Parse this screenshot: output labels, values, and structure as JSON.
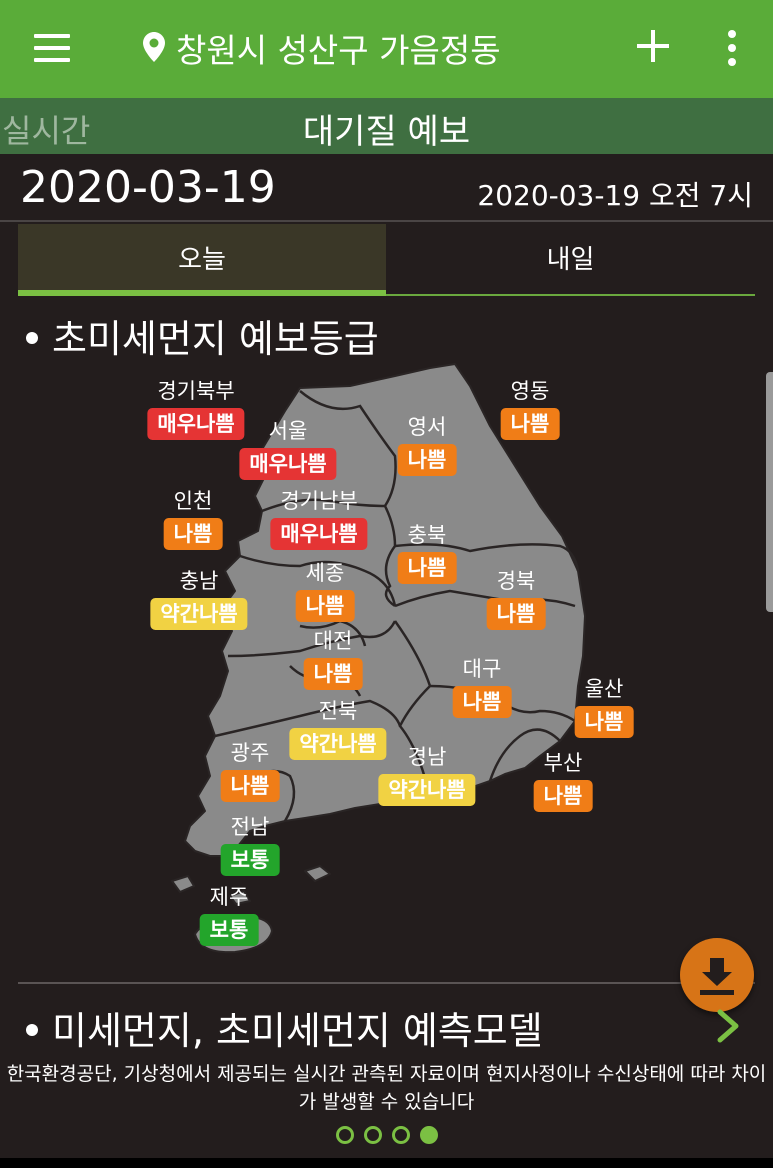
{
  "appbar": {
    "location": "창원시 성산구 가음정동",
    "menu_icon": "hamburger-menu-icon",
    "location_icon": "map-pin-icon",
    "add_icon": "plus-icon",
    "more_icon": "more-vertical-icon"
  },
  "subbar": {
    "prev_label": "실시간",
    "title": "대기질 예보"
  },
  "dateline": {
    "date": "2020-03-19",
    "updated": "2020-03-19 오전 7시"
  },
  "tabs": {
    "today": "오늘",
    "tomorrow": "내일"
  },
  "section1": {
    "title": "초미세먼지 예보등급"
  },
  "section2": {
    "title": "미세먼지, 초미세먼지 예측모델"
  },
  "grade_colors": {
    "매우나쁨": "#e53434",
    "나쁨": "#f07d17",
    "약간나쁨": "#f1d243",
    "보통": "#23a52b"
  },
  "regions": [
    {
      "name": "경기북부",
      "grade": "매우나쁨"
    },
    {
      "name": "서울",
      "grade": "매우나쁨"
    },
    {
      "name": "영서",
      "grade": "나쁨"
    },
    {
      "name": "영동",
      "grade": "나쁨"
    },
    {
      "name": "인천",
      "grade": "나쁨"
    },
    {
      "name": "경기남부",
      "grade": "매우나쁨"
    },
    {
      "name": "충북",
      "grade": "나쁨"
    },
    {
      "name": "충남",
      "grade": "약간나쁨"
    },
    {
      "name": "세종",
      "grade": "나쁨"
    },
    {
      "name": "경북",
      "grade": "나쁨"
    },
    {
      "name": "대전",
      "grade": "나쁨"
    },
    {
      "name": "대구",
      "grade": "나쁨"
    },
    {
      "name": "울산",
      "grade": "나쁨"
    },
    {
      "name": "전북",
      "grade": "약간나쁨"
    },
    {
      "name": "광주",
      "grade": "나쁨"
    },
    {
      "name": "경남",
      "grade": "약간나쁨"
    },
    {
      "name": "부산",
      "grade": "나쁨"
    },
    {
      "name": "전남",
      "grade": "보통"
    },
    {
      "name": "제주",
      "grade": "보통"
    }
  ],
  "download_icon": "download-icon",
  "next_icon": "chevron-right-icon",
  "notice": "한국환경공단, 기상청에서 제공되는 실시간 관측된 자료이며 현지사정이나 수신상태에 따라 차이가 발생할 수 있습니다",
  "pager": {
    "pages": 4,
    "active": 4
  }
}
